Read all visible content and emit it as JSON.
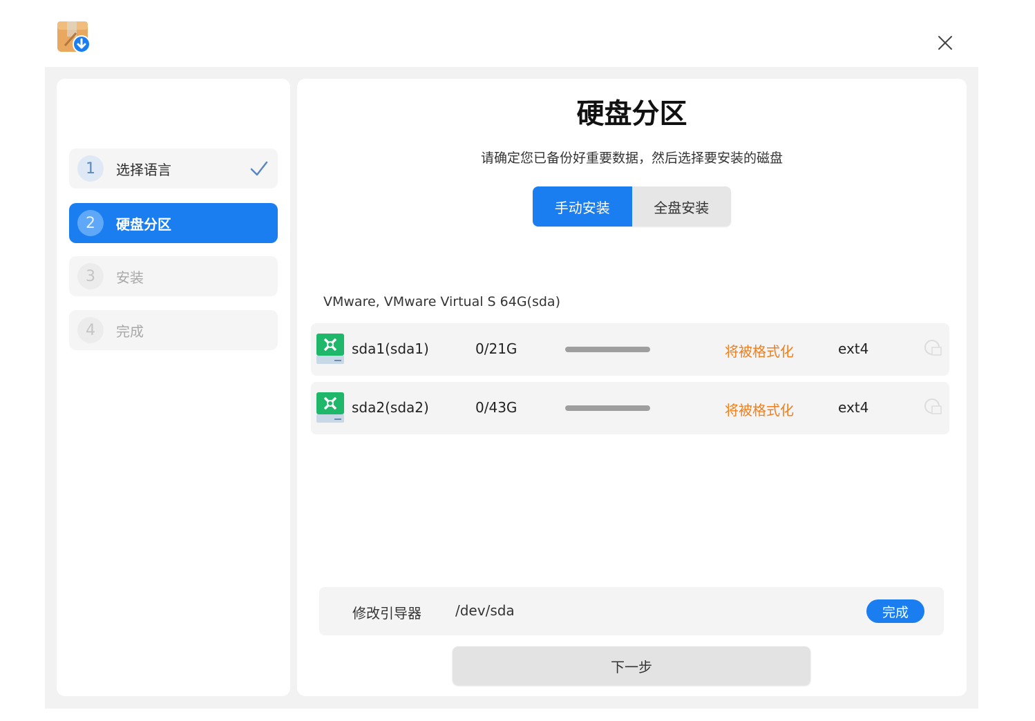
{
  "window": {
    "close_icon": "close-icon",
    "app_icon": "installer-package-icon"
  },
  "sidebar": {
    "steps": [
      {
        "num": "1",
        "label": "选择语言",
        "state": "done"
      },
      {
        "num": "2",
        "label": "硬盘分区",
        "state": "active"
      },
      {
        "num": "3",
        "label": "安装",
        "state": "pending"
      },
      {
        "num": "4",
        "label": "完成",
        "state": "pending"
      }
    ]
  },
  "main": {
    "title": "硬盘分区",
    "subtitle": "请确定您已备份好重要数据，然后选择要安装的磁盘",
    "modes": [
      {
        "label": "手动安装",
        "selected": true
      },
      {
        "label": "全盘安装",
        "selected": false
      }
    ],
    "disk": {
      "label": "VMware, VMware Virtual S 64G(sda)",
      "partitions": [
        {
          "name": "sda1(sda1)",
          "usage": "0/21G",
          "used_fraction": 0,
          "status": "将被格式化",
          "fs": "ext4"
        },
        {
          "name": "sda2(sda2)",
          "usage": "0/43G",
          "used_fraction": 0,
          "status": "将被格式化",
          "fs": "ext4"
        }
      ]
    },
    "bootloader": {
      "label": "修改引导器",
      "path": "/dev/sda",
      "done_label": "完成"
    },
    "next_label": "下一步"
  },
  "colors": {
    "accent": "#1a7ef0",
    "warning": "#f07f1b",
    "disk_icon": "#1fb86a"
  }
}
